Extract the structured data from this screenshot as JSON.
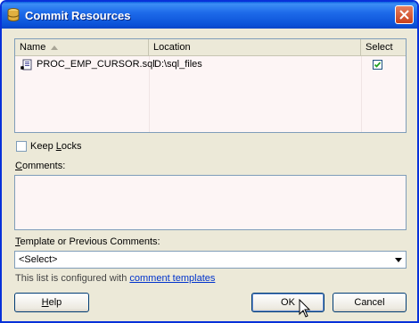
{
  "window": {
    "title": "Commit Resources",
    "close_label": "×"
  },
  "table": {
    "headers": {
      "name": "Name",
      "location": "Location",
      "select": "Select"
    },
    "rows": [
      {
        "name": "PROC_EMP_CURSOR.sql",
        "location": "D:\\sql_files",
        "selected": true
      }
    ]
  },
  "keep_locks": {
    "label_prefix": "Keep ",
    "label_mnemonic": "L",
    "label_suffix": "ocks",
    "checked": false
  },
  "comments": {
    "label_mnemonic": "C",
    "label_suffix": "omments:",
    "value": ""
  },
  "template": {
    "label_mnemonic": "T",
    "label_suffix": "emplate or Previous Comments:",
    "selected": "<Select>"
  },
  "info": {
    "text": "This list is configured with ",
    "link": "comment templates"
  },
  "buttons": {
    "help_mnemonic": "H",
    "help_suffix": "elp",
    "ok": "OK",
    "cancel": "Cancel"
  },
  "colors": {
    "title_bar": "#0b52d8",
    "dialog_bg": "#ece9d8",
    "list_bg": "#fdf5f5",
    "link": "#0033cc"
  }
}
